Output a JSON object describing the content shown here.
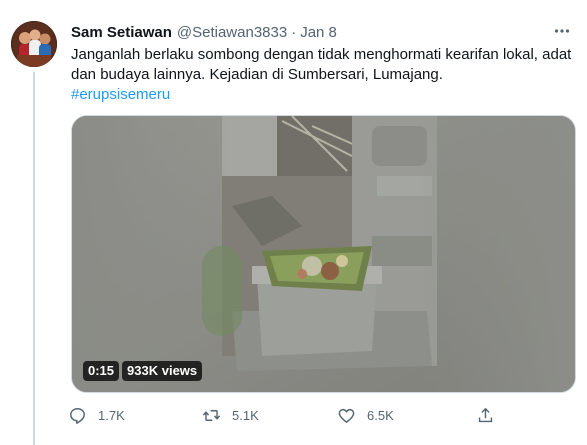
{
  "tweet": {
    "author_name": "Sam Setiawan",
    "handle": "@Setiawan3833",
    "separator": "·",
    "date": "Jan 8",
    "text_line1": "Janganlah berlaku sombong dengan tidak menghormati kearifan lokal, adat",
    "text_line2": "dan budaya lainnya. Kejadian di Sumbersari, Lumajang.",
    "hashtag": "#erupsisemeru",
    "video": {
      "duration": "0:15",
      "views": "933K views"
    },
    "actions": {
      "reply_count": "1.7K",
      "retweet_count": "5.1K",
      "like_count": "6.5K"
    }
  },
  "icons": {
    "more": "more-horizontal-icon",
    "reply": "reply-icon",
    "retweet": "retweet-icon",
    "like": "heart-icon",
    "share": "share-icon"
  },
  "colors": {
    "link": "#1d9bf0",
    "secondary_text": "#536471",
    "primary_text": "#0f1419"
  }
}
